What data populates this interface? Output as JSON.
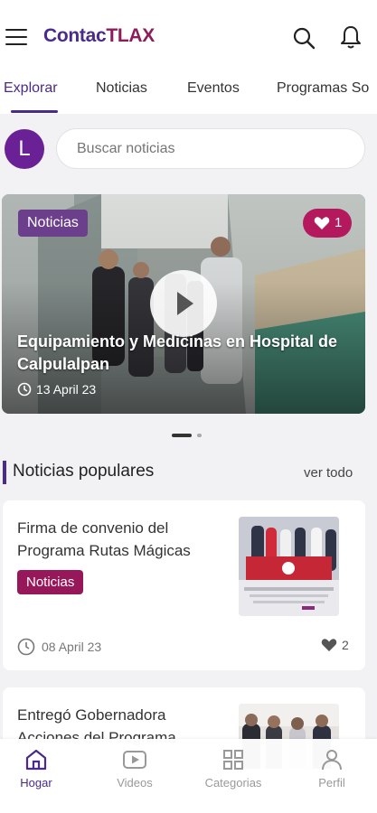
{
  "app": {
    "logo_part1": "Contac",
    "logo_part2": "TLAX"
  },
  "header": {
    "icons": [
      "menu-icon",
      "search-icon",
      "bell-icon"
    ]
  },
  "tabs": [
    {
      "label": "Explorar",
      "active": true
    },
    {
      "label": "Noticias",
      "active": false
    },
    {
      "label": "Eventos",
      "active": false
    },
    {
      "label": "Programas So",
      "active": false
    }
  ],
  "user": {
    "avatar_letter": "L"
  },
  "search": {
    "placeholder": "Buscar noticias"
  },
  "featured": {
    "category": "Noticias",
    "likes": "1",
    "title": "Equipamiento y Medicinas en Hospital de Calpulalpan",
    "date": "13 April 23",
    "carousel_index": 1,
    "carousel_count": 2
  },
  "popular": {
    "title": "Noticias populares",
    "see_all": "ver todo",
    "items": [
      {
        "title": "Firma de convenio del Programa Rutas Mágicas",
        "category": "Noticias",
        "date": "08 April 23",
        "likes": "2"
      },
      {
        "title": "Entregó Gobernadora Acciones del Programa",
        "category": "",
        "date": "",
        "likes": ""
      }
    ]
  },
  "bottom_nav": [
    {
      "label": "Hogar",
      "icon": "home-icon",
      "active": true
    },
    {
      "label": "Videos",
      "icon": "video-icon",
      "active": false
    },
    {
      "label": "Categorias",
      "icon": "grid-icon",
      "active": false
    },
    {
      "label": "Perfil",
      "icon": "user-icon",
      "active": false
    }
  ],
  "colors": {
    "primary": "#4a2a8a",
    "accent": "#8e1b5a",
    "chip": "#96185a"
  }
}
